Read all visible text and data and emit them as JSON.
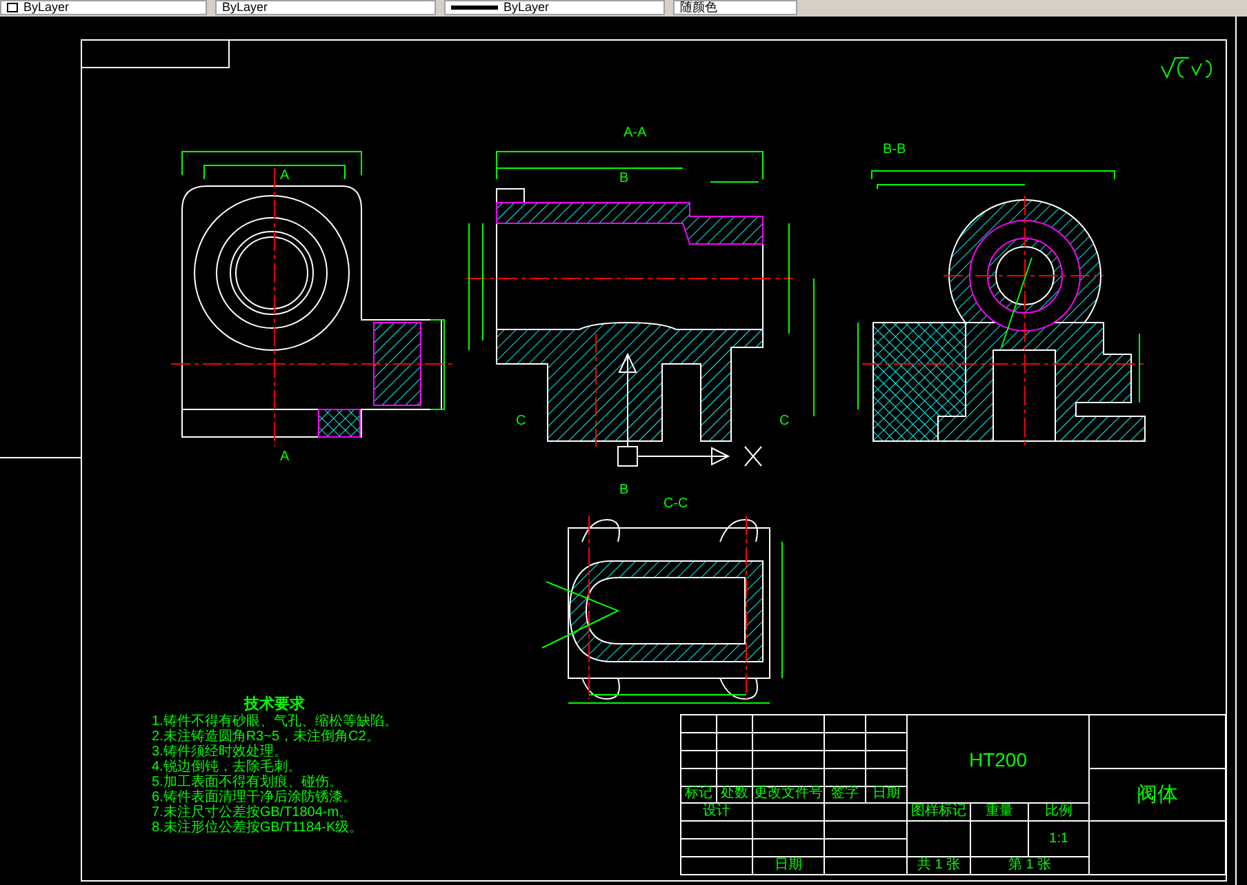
{
  "toolbar": {
    "dropdowns": [
      {
        "kind": "color",
        "label": "ByLayer"
      },
      {
        "kind": "linetype",
        "label": "ByLayer"
      },
      {
        "kind": "lineweight",
        "label": "ByLayer"
      },
      {
        "kind": "plotstyle",
        "label": "随颜色"
      }
    ]
  },
  "drawing": {
    "view_labels": [
      {
        "label": "A-A"
      },
      {
        "label": "B-B"
      },
      {
        "label": "C-C"
      }
    ],
    "section_marks": [
      {
        "label": "A"
      },
      {
        "label": "A"
      },
      {
        "label": "B"
      },
      {
        "label": "B"
      },
      {
        "label": "C"
      },
      {
        "label": "C"
      }
    ],
    "technical_requirements": {
      "title": "技术要求",
      "items": [
        "1.铸件不得有砂眼、气孔、缩松等缺陷。",
        "2.未注铸造圆角R3~5，未注倒角C2。",
        "3.铸件须经时效处理。",
        "4.锐边倒钝，去除毛刺。",
        "5.加工表面不得有划痕、碰伤。",
        "6.铸件表面清理干净后涂防锈漆。",
        "7.未注尺寸公差按GB/T1804-m。",
        "8.未注形位公差按GB/T1184-K级。"
      ]
    }
  },
  "title_block": {
    "material": "HT200",
    "part_name": "阀体",
    "revision_headers": [
      "标记",
      "处数",
      "更改文件号",
      "签字",
      "日期"
    ],
    "designer_label": "设计",
    "date_label": "日期",
    "attribute_headers": [
      "图样标记",
      "重量",
      "比例"
    ],
    "scale": "1:1",
    "sheet_total": "共 1 张",
    "sheet_number": "第 1 张"
  }
}
